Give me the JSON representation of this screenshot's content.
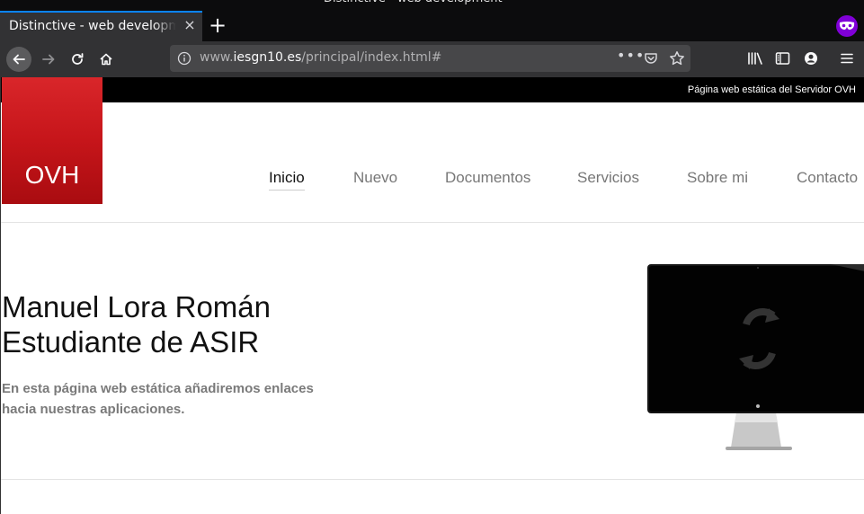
{
  "browser": {
    "tab": {
      "title": "Distinctive - web development",
      "close_glyph": "×"
    },
    "new_tab_glyph": "+",
    "url": {
      "prefix": "www.",
      "host": "iesgn10.es",
      "path": "/principal/index.html#"
    },
    "url_more_glyph": "•••",
    "icons": [
      "back-icon",
      "forward-icon",
      "reload-icon",
      "home-icon",
      "site-info-icon",
      "pocket-icon",
      "bookmark-star-icon",
      "library-icon",
      "sidebar-icon",
      "account-icon",
      "hamburger-menu-icon",
      "private-browsing-icon"
    ],
    "colors": {
      "chrome": "#323234",
      "tabstrip": "#0c0c0d",
      "urlbar": "#474749",
      "accent": "#0a84ff",
      "private": "#8000d7"
    }
  },
  "site": {
    "topbar_text": "Página web estática del Servidor OVH",
    "logo_text": "OVH",
    "nav": [
      {
        "label": "Inicio",
        "active": true
      },
      {
        "label": "Nuevo",
        "active": false
      },
      {
        "label": "Documentos",
        "active": false
      },
      {
        "label": "Servicios",
        "active": false
      },
      {
        "label": "Sobre mi",
        "active": false
      },
      {
        "label": "Contacto",
        "active": false
      }
    ],
    "hero": {
      "title_line1": "Manuel Lora Román",
      "title_line2": "Estudiante de ASIR",
      "description": "En esta página web estática añadiremos enlaces hacia nuestras aplicaciones."
    },
    "colors": {
      "logo": "#c6151a",
      "topbar": "#000000",
      "nav_inactive": "#777777",
      "nav_active": "#111111"
    }
  }
}
